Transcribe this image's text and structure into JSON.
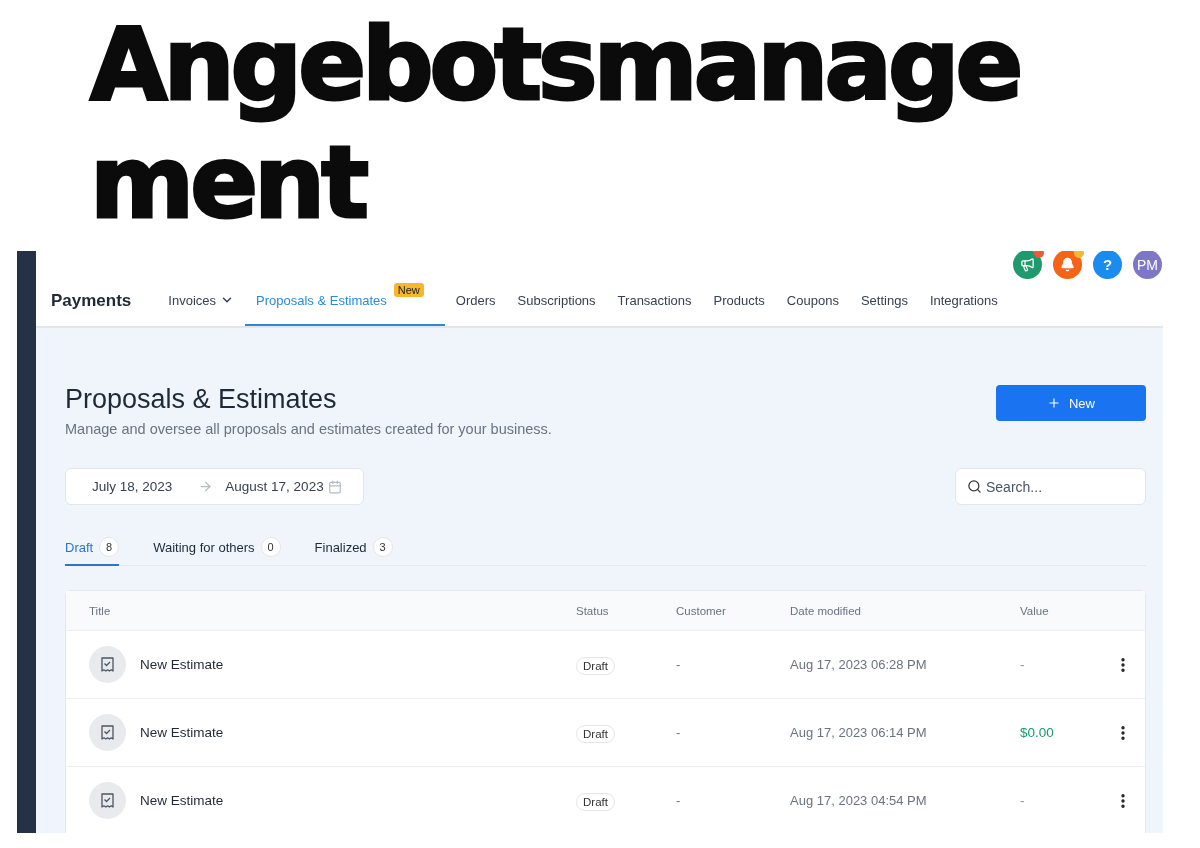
{
  "headline": [
    "Angebotsmanage",
    "ment"
  ],
  "header": {
    "brand": "Payments",
    "avatar": "PM",
    "help": "?",
    "nav": [
      {
        "label": "Invoices",
        "selected": false,
        "dropdown": true
      },
      {
        "label": "Proposals & Estimates",
        "selected": true,
        "badge": "New"
      },
      {
        "label": "Orders",
        "selected": false
      },
      {
        "label": "Subscriptions",
        "selected": false
      },
      {
        "label": "Transactions",
        "selected": false
      },
      {
        "label": "Products",
        "selected": false
      },
      {
        "label": "Coupons",
        "selected": false
      },
      {
        "label": "Settings",
        "selected": false
      },
      {
        "label": "Integrations",
        "selected": false
      }
    ]
  },
  "page": {
    "title": "Proposals & Estimates",
    "subtitle": "Manage and oversee all proposals and estimates created for your business.",
    "new_button": "New",
    "date_from": "July 18, 2023",
    "date_to": "August 17, 2023",
    "search": {
      "placeholder": "Search..."
    }
  },
  "tabs": [
    {
      "label": "Draft",
      "count": "8",
      "selected": true
    },
    {
      "label": "Waiting for others",
      "count": "0",
      "selected": false
    },
    {
      "label": "Finalized",
      "count": "3",
      "selected": false
    }
  ],
  "table": {
    "columns": [
      "Title",
      "Status",
      "Customer",
      "Date modified",
      "Value"
    ],
    "rows": [
      {
        "title": "New Estimate",
        "status": "Draft",
        "customer": "-",
        "date": "Aug 17, 2023 06:28 PM",
        "value": "-"
      },
      {
        "title": "New Estimate",
        "status": "Draft",
        "customer": "-",
        "date": "Aug 17, 2023 06:14 PM",
        "value": "$0.00",
        "color": "#1a9a6c"
      },
      {
        "title": "New Estimate",
        "status": "Draft",
        "customer": "-",
        "date": "Aug 17, 2023 04:54 PM",
        "value": "-"
      }
    ]
  }
}
